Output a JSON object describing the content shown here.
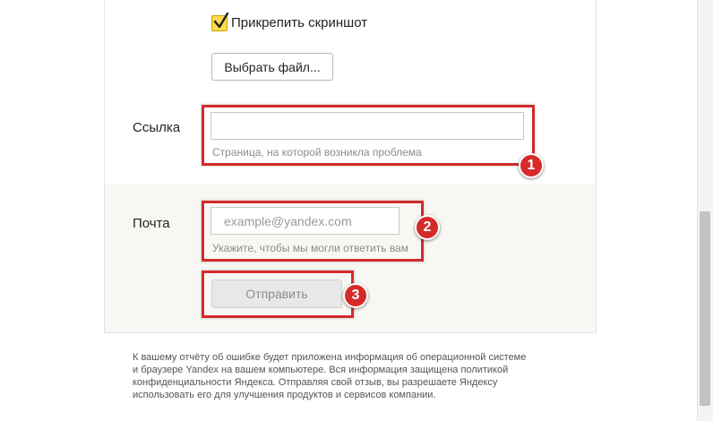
{
  "attachment": {
    "checkbox_label": "Прикрепить скриншот",
    "checked": true,
    "choose_file_label": "Выбрать файл..."
  },
  "link": {
    "label": "Ссылка",
    "value": "",
    "hint": "Страница, на которой возникла проблема"
  },
  "email": {
    "label": "Почта",
    "placeholder": "example@yandex.com",
    "hint": "Укажите, чтобы мы могли ответить вам"
  },
  "submit": {
    "label": "Отправить"
  },
  "annotations": {
    "badge_1": "1",
    "badge_2": "2",
    "badge_3": "3",
    "highlight_color": "#d22b2b"
  },
  "footer": {
    "lines": [
      "К вашему отчёту об ошибке будет приложена информация об операционной системе",
      "и браузере Yandex на вашем компьютере. Вся информация защищена политикой",
      "конфиденциальности Яндекса. Отправляя свой отзыв, вы разрешаете Яндексу",
      "использовать его для улучшения продуктов и сервисов компании."
    ]
  }
}
